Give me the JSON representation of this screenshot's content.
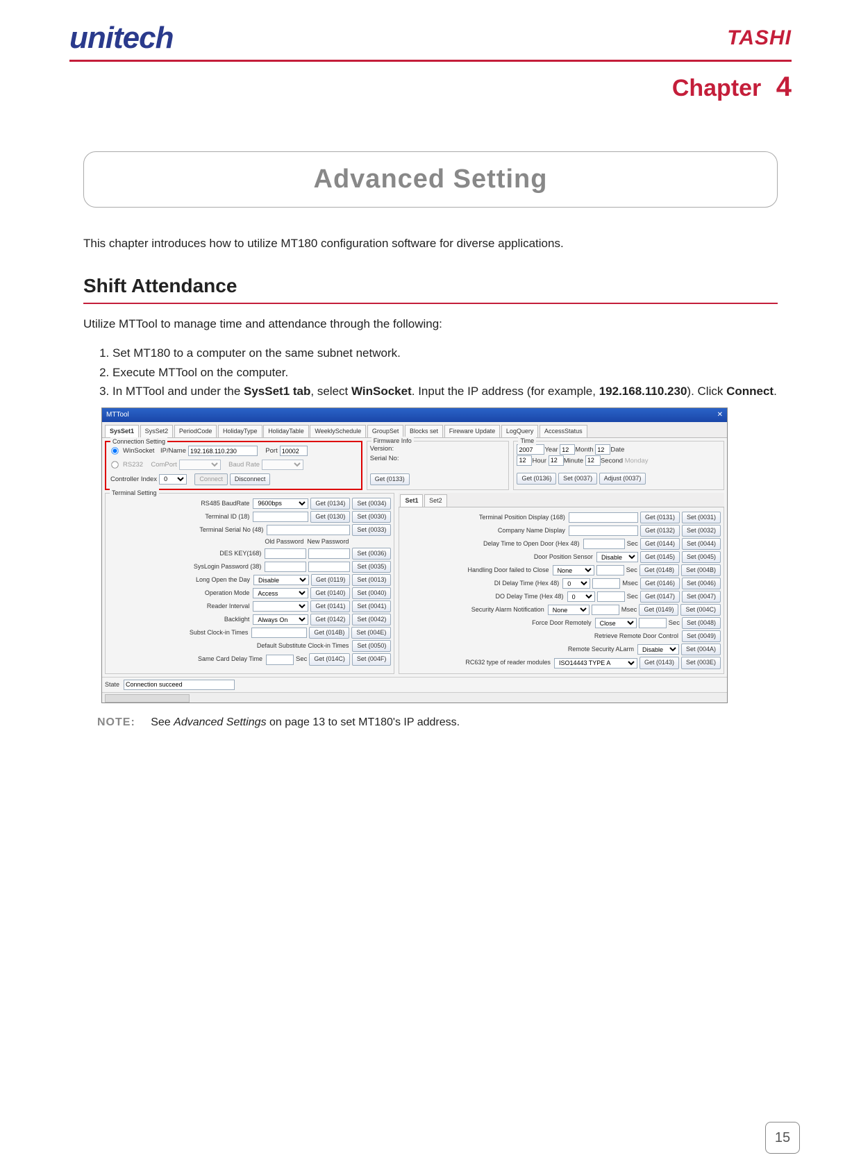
{
  "header": {
    "left_logo": "unitech",
    "right_logo": "TASHI"
  },
  "chapter": {
    "label": "Chapter",
    "number": "4"
  },
  "title_box": "Advanced Setting",
  "intro": "This chapter introduces how to utilize MT180 configuration software for diverse applications.",
  "section1": {
    "heading": "Shift Attendance",
    "lead": "Utilize MTTool to manage time and attendance through the following:",
    "steps": {
      "s1": "Set MT180 to a computer on the same subnet network.",
      "s2": "Execute MTTool on the computer.",
      "s3a": "In MTTool and under the ",
      "s3b": "SysSet1 tab",
      "s3c": ", select ",
      "s3d": "WinSocket",
      "s3e": ". Input the IP address (for example, ",
      "s3f": "192.168.110.230",
      "s3g": "). Click ",
      "s3h": "Connect",
      "s3i": "."
    }
  },
  "note": {
    "label": "NOTE:",
    "pre": "See ",
    "ital": "Advanced Settings",
    "post": " on page 13 to set MT180's IP address."
  },
  "page_number": "15",
  "shot": {
    "title": "MTTool",
    "tabs": [
      "SysSet1",
      "SysSet2",
      "PeriodCode",
      "HolidayType",
      "HolidayTable",
      "WeeklySchedule",
      "GroupSet",
      "Blocks set",
      "Fireware Update",
      "LogQuery",
      "AccessStatus"
    ],
    "conn": {
      "legend": "Connection Setting",
      "winsocket": "WinSocket",
      "ipname_lbl": "IP/Name",
      "ipname_val": "192.168.110.230",
      "port_lbl": "Port",
      "port_val": "10002",
      "rs232": "RS232",
      "comport_lbl": "ComPort",
      "baud_lbl": "Baud Rate",
      "ctrl_idx_lbl": "Controller Index",
      "ctrl_idx_val": "0",
      "connect": "Connect",
      "disconnect": "Disconnect"
    },
    "firmware": {
      "legend": "Firmware Info",
      "version": "Version:",
      "serial": "Serial No:",
      "get": "Get (0133)"
    },
    "time": {
      "legend": "Time",
      "year_v": "2007",
      "year_l": "Year",
      "mon_v": "12",
      "mon_l": "Month",
      "date_v": "12",
      "date_l": "Date",
      "hour_v": "12",
      "hour_l": "Hour",
      "min_v": "12",
      "min_l": "Minute",
      "sec_v": "12",
      "sec_l": "Second",
      "dow": "Monday",
      "get": "Get (0136)",
      "set": "Set (0037)",
      "adjust": "Adjust (0037)"
    },
    "term": {
      "legend": "Terminal Setting",
      "rows": {
        "baud": "RS485 BaudRate",
        "baud_v": "9600bps",
        "g134": "Get (0134)",
        "s34": "Set (0034)",
        "tid": "Terminal ID (18)",
        "g130": "Get (0130)",
        "s30": "Set (0030)",
        "tsn": "Terminal Serial No (48)",
        "s33": "Set (0033)",
        "oldpw": "Old Password",
        "newpw": "New Password",
        "des": "DES KEY(168)",
        "s36": "Set (0036)",
        "slp": "SysLogin Password (38)",
        "s35": "Set (0035)",
        "lod": "Long Open the Day",
        "lod_v": "Disable",
        "g119": "Get (0119)",
        "s13": "Set (0013)",
        "op": "Operation Mode",
        "op_v": "Access",
        "g140": "Get (0140)",
        "s40": "Set (0040)",
        "ri": "Reader Interval",
        "g141": "Get (0141)",
        "s41": "Set (0041)",
        "bl": "Backlight",
        "bl_v": "Always On",
        "g142": "Get (0142)",
        "s42": "Set (0042)",
        "sct": "Subst Clock-in Times",
        "g14B": "Get (014B)",
        "s4E": "Set (004E)",
        "dsct": "Default Substitute Clock-in Times",
        "s50": "Set (0050)",
        "scdt": "Same Card Delay Time",
        "sec": "Sec",
        "g14C": "Get (014C)",
        "s4F": "Set (004F)"
      }
    },
    "set_tabs": [
      "Set1",
      "Set2"
    ],
    "right": {
      "tpd": "Terminal Position Display (168)",
      "g131": "Get (0131)",
      "s31": "Set (0031)",
      "cnd": "Company Name Display",
      "g132": "Get (0132)",
      "s32": "Set (0032)",
      "dto": "Delay Time to Open Door (Hex 48)",
      "secu": "Sec",
      "g144": "Get (0144)",
      "s44": "Set (0044)",
      "dps": "Door Position Sensor",
      "dps_v": "Disable",
      "g145": "Get (0145)",
      "s45": "Set (0045)",
      "hdf": "Handling Door failed to Close",
      "hdf_v": "None",
      "g148": "Get (0148)",
      "s4B": "Set (004B)",
      "didly": "DI Delay Time (Hex 48)",
      "didly_v": "0",
      "msec": "Msec",
      "g146": "Get (0146)",
      "s46": "Set (0046)",
      "dodly": "DO Delay Time (Hex 48)",
      "dodly_v": "0",
      "g147": "Get (0147)",
      "s47": "Set (0047)",
      "san": "Security Alarm Notification",
      "san_v": "None",
      "g149": "Get (0149)",
      "s4C": "Set (004C)",
      "fdr": "Force Door Remotely",
      "fdr_v": "Close",
      "s48": "Set (0048)",
      "rrdc": "Retrieve Remote Door Control",
      "s49": "Set (0049)",
      "rsa": "Remote Security ALarm",
      "rsa_v": "Disable",
      "s4A": "Set (004A)",
      "rc632": "RC632 type of reader modules",
      "rc632_v": "ISO14443 TYPE A",
      "g143": "Get (0143)",
      "s3E": "Set (003E)"
    },
    "state_lbl": "State",
    "state_val": "Connection succeed"
  }
}
